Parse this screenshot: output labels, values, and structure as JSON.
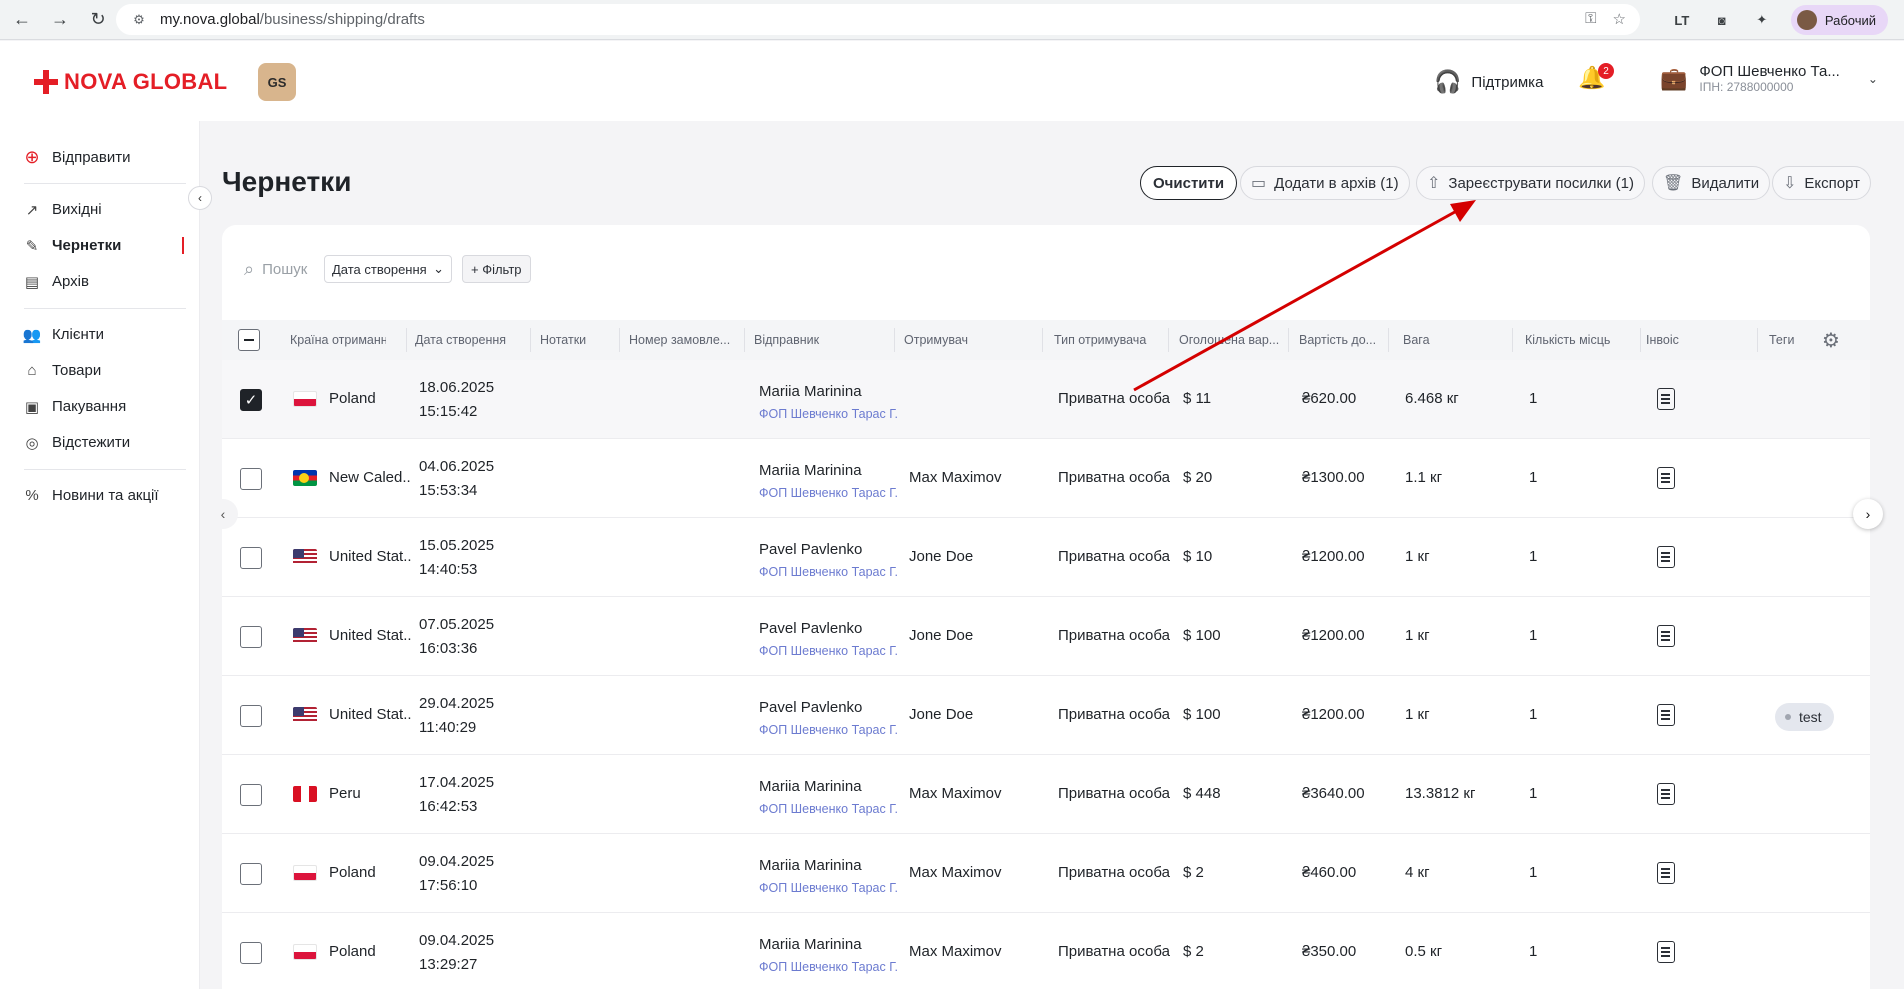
{
  "browser": {
    "url_host": "my.nova.global",
    "url_path": "/business/shipping/drafts",
    "ext_label": "LT",
    "profile_label": "Рабочий"
  },
  "header": {
    "logo_text": "NOVA GLOBAL",
    "badge_text": "GS",
    "support_label": "Підтримка",
    "notifications_count": "2",
    "account_name": "ФОП Шевченко Та...",
    "account_tax": "ІПН: 2788000000"
  },
  "sidebar": {
    "send_label": "Відправити",
    "items": [
      {
        "label": "Вихідні"
      },
      {
        "label": "Чернетки"
      },
      {
        "label": "Архів"
      },
      {
        "label": "Клієнти"
      },
      {
        "label": "Товари"
      },
      {
        "label": "Пакування"
      },
      {
        "label": "Відстежити"
      },
      {
        "label": "Новини та акції"
      }
    ]
  },
  "page": {
    "title": "Чернетки",
    "actions": {
      "clear": "Очистити",
      "archive": "Додати в архів (1)",
      "register": "Зареєструвати посилки (1)",
      "delete": "Видалити",
      "export": "Експорт"
    }
  },
  "toolbar": {
    "search_placeholder": "Пошук",
    "date_select": "Дата створення",
    "filter_label": "+ Фільтр"
  },
  "table": {
    "columns": [
      "Країна отримання",
      "Дата створення",
      "Нотатки",
      "Номер замовле...",
      "Відправник",
      "Отримувач",
      "Тип отримувача",
      "Оголошена вар...",
      "Вартість до...",
      "Вага",
      "Кількість місць",
      "Інвоіс",
      "Теги"
    ],
    "rows": [
      {
        "selected": true,
        "flag": "poland",
        "country": "Poland",
        "date": "18.06.2025",
        "time": "15:15:42",
        "sender": "Mariia Marinina",
        "sender_company": "ФОП Шевченко Тарас Г...",
        "recipient": "",
        "recipient_type": "Приватна особа",
        "declared": "$ 11",
        "delivery": "₴620.00",
        "weight": "6.468 кг",
        "places": "1",
        "tag": ""
      },
      {
        "selected": false,
        "flag": "newcal",
        "country": "New Caled...",
        "date": "04.06.2025",
        "time": "15:53:34",
        "sender": "Mariia Marinina",
        "sender_company": "ФОП Шевченко Тарас Г...",
        "recipient": "Max Maximov",
        "recipient_type": "Приватна особа",
        "declared": "$ 20",
        "delivery": "₴1300.00",
        "weight": "1.1 кг",
        "places": "1",
        "tag": ""
      },
      {
        "selected": false,
        "flag": "usa",
        "country": "United Stat...",
        "date": "15.05.2025",
        "time": "14:40:53",
        "sender": "Pavel Pavlenko",
        "sender_company": "ФОП Шевченко Тарас Г...",
        "recipient": "Jone Doe",
        "recipient_type": "Приватна особа",
        "declared": "$ 10",
        "delivery": "₴1200.00",
        "weight": "1 кг",
        "places": "1",
        "tag": ""
      },
      {
        "selected": false,
        "flag": "usa",
        "country": "United Stat...",
        "date": "07.05.2025",
        "time": "16:03:36",
        "sender": "Pavel Pavlenko",
        "sender_company": "ФОП Шевченко Тарас Г...",
        "recipient": "Jone Doe",
        "recipient_type": "Приватна особа",
        "declared": "$ 100",
        "delivery": "₴1200.00",
        "weight": "1 кг",
        "places": "1",
        "tag": ""
      },
      {
        "selected": false,
        "flag": "usa",
        "country": "United Stat...",
        "date": "29.04.2025",
        "time": "11:40:29",
        "sender": "Pavel Pavlenko",
        "sender_company": "ФОП Шевченко Тарас Г...",
        "recipient": "Jone Doe",
        "recipient_type": "Приватна особа",
        "declared": "$ 100",
        "delivery": "₴1200.00",
        "weight": "1 кг",
        "places": "1",
        "tag": "test"
      },
      {
        "selected": false,
        "flag": "peru",
        "country": "Peru",
        "date": "17.04.2025",
        "time": "16:42:53",
        "sender": "Mariia Marinina",
        "sender_company": "ФОП Шевченко Тарас Г...",
        "recipient": "Max Maximov",
        "recipient_type": "Приватна особа",
        "declared": "$ 448",
        "delivery": "₴3640.00",
        "weight": "13.3812 кг",
        "places": "1",
        "tag": ""
      },
      {
        "selected": false,
        "flag": "poland",
        "country": "Poland",
        "date": "09.04.2025",
        "time": "17:56:10",
        "sender": "Mariia Marinina",
        "sender_company": "ФОП Шевченко Тарас Г...",
        "recipient": "Max Maximov",
        "recipient_type": "Приватна особа",
        "declared": "$ 2",
        "delivery": "₴460.00",
        "weight": "4 кг",
        "places": "1",
        "tag": ""
      },
      {
        "selected": false,
        "flag": "poland",
        "country": "Poland",
        "date": "09.04.2025",
        "time": "13:29:27",
        "sender": "Mariia Marinina",
        "sender_company": "ФОП Шевченко Тарас Г...",
        "recipient": "Max Maximov",
        "recipient_type": "Приватна особа",
        "declared": "$ 2",
        "delivery": "₴350.00",
        "weight": "0.5 кг",
        "places": "1",
        "tag": ""
      }
    ]
  },
  "colors": {
    "brand_red": "#e41e26",
    "annotation_arrow": "#d40000",
    "link_blue": "#6c7bd0"
  }
}
